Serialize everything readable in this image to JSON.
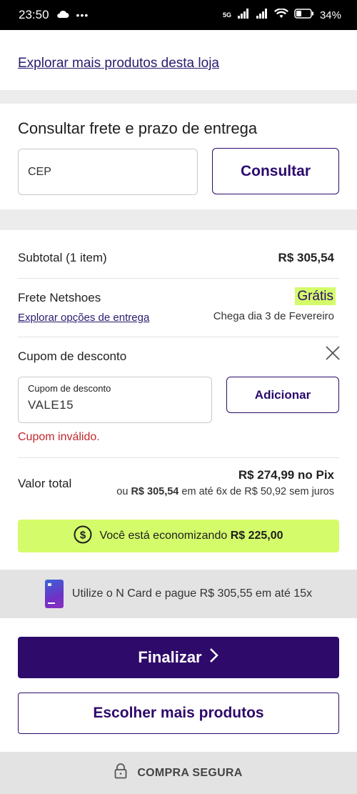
{
  "status_bar": {
    "time": "23:50",
    "network": "5G",
    "battery": "34%"
  },
  "explore_link": "Explorar mais produtos desta loja",
  "shipping": {
    "title": "Consultar frete e prazo de entrega",
    "cep_placeholder": "CEP",
    "consult_label": "Consultar"
  },
  "summary": {
    "subtotal_label": "Subtotal (1 item)",
    "subtotal_value": "R$ 305,54",
    "freight_label": "Frete Netshoes",
    "freight_value": "Grátis",
    "delivery_options_link": "Explorar opções de entrega",
    "delivery_date": "Chega dia 3 de Fevereiro",
    "coupon_title": "Cupom de desconto",
    "coupon_field_label": "Cupom de desconto",
    "coupon_value": "VALE15",
    "add_label": "Adicionar",
    "coupon_error": "Cupom inválido.",
    "total_label": "Valor total",
    "total_pix": "R$ 274,99 no Pix",
    "total_alt_prefix": "ou",
    "total_alt_value": "R$ 305,54",
    "total_alt_suffix": "em até 6x de R$ 50,92 sem juros",
    "saving_text": "Você está economizando",
    "saving_value": "R$ 225,00"
  },
  "ncard": {
    "text": "Utilize o N Card e pague R$ 305,55 em até 15x"
  },
  "actions": {
    "finalize_label": "Finalizar",
    "more_products_label": "Escolher mais produtos"
  },
  "secure": {
    "label": "COMPRA SEGURA"
  },
  "colors": {
    "brand": "#2e0a6b",
    "highlight": "#d4fb6a",
    "error": "#c0272d"
  }
}
